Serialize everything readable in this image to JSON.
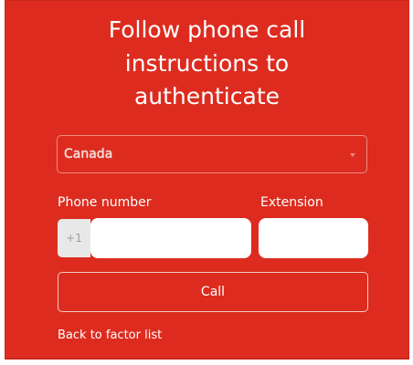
{
  "header": {
    "title_line1": "Follow phone call",
    "title_line2": "instructions to",
    "title_line3": "authenticate"
  },
  "country_select": {
    "selected": "Canada",
    "icon": "chevron-down-icon"
  },
  "phone": {
    "label": "Phone number",
    "prefix": "+1",
    "value": "",
    "placeholder": ""
  },
  "extension": {
    "label": "Extension",
    "value": "",
    "placeholder": ""
  },
  "actions": {
    "call_label": "Call",
    "back_link": "Back to factor list"
  },
  "colors": {
    "panel_background": "#dd2c1f",
    "text": "#ffffff",
    "input_background": "#ffffff",
    "prefix_background": "#e8e8e8"
  }
}
